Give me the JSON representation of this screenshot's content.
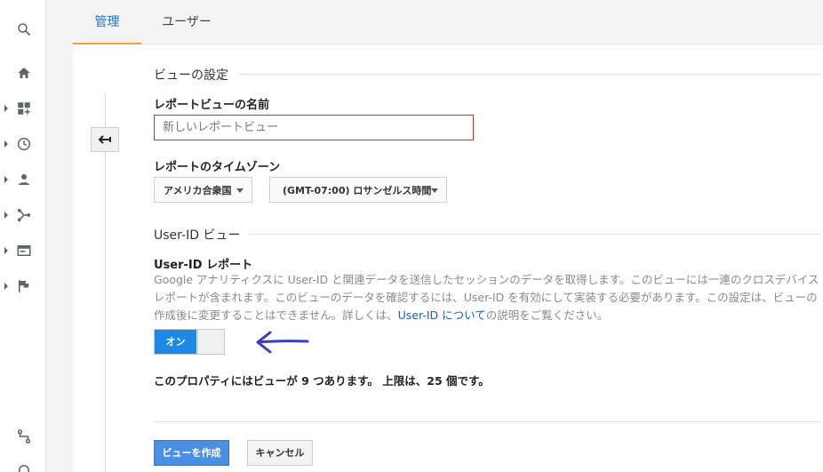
{
  "tabs": [
    {
      "label": "管理",
      "active": true
    },
    {
      "label": "ユーザー",
      "active": false
    }
  ],
  "nav_icons": [
    "search-icon",
    "home-icon",
    "dashboard-icon",
    "clock-icon",
    "person-icon",
    "acquisition-icon",
    "behavior-icon",
    "flag-icon",
    "attribution-icon",
    "discover-icon"
  ],
  "view_settings": {
    "section_title": "ビューの設定",
    "report_view_name_label": "レポートビューの名前",
    "report_view_name_placeholder": "新しいレポートビュー",
    "timezone_label": "レポートのタイムゾーン",
    "country_select": "アメリカ合衆国",
    "timezone_select": "(GMT-07:00) ロサンゼルス時間"
  },
  "userid": {
    "section_title": "User-ID ビュー",
    "report_label": "User-ID レポート",
    "desc_part1": "Google アナリティクスに User-ID と関連データを送信したセッションのデータを取得します。このビューには一連のクロスデバイス レポートが含まれます。このビューのデータを確認するには、User-ID を有効にして実装する必要があります。この設定は、ビューの作成後に変更することはできません。詳しくは、",
    "desc_link": "User-ID について",
    "desc_part2": "の説明をご覧ください。",
    "toggle_label": "オン",
    "toggle_on": true
  },
  "views_count_text": "このプロパティにはビューが 9 つあります。 上限は、25 個です。",
  "buttons": {
    "create": "ビューを作成",
    "cancel": "キャンセル"
  },
  "colors": {
    "accent_blue": "#1a73e8",
    "tab_underline": "#f2a33a",
    "toggle_blue": "#1e88e5",
    "error_border": "#c0392b",
    "annotation_arrow": "#3b3fbf"
  }
}
